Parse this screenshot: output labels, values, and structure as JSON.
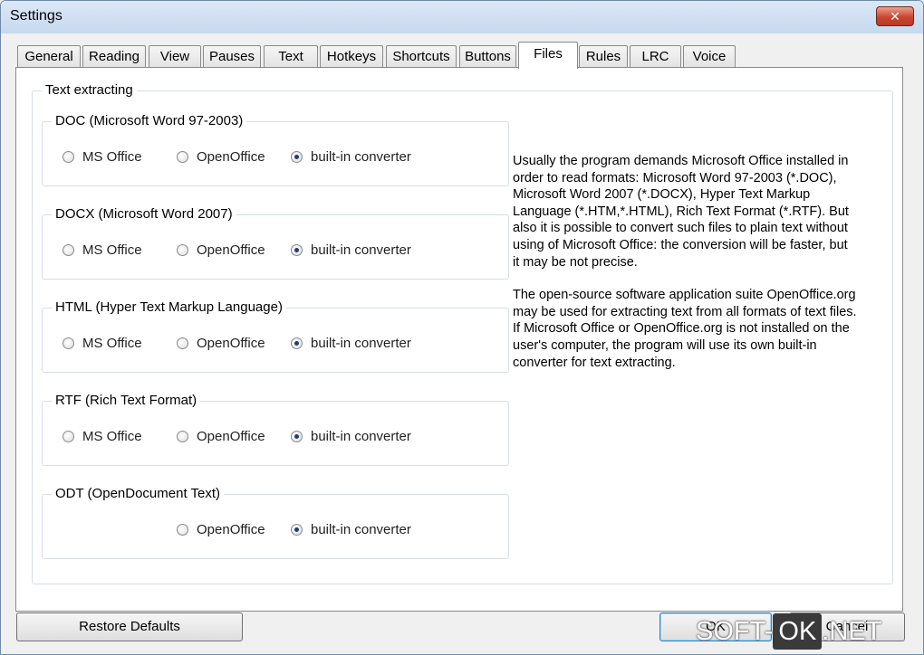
{
  "window": {
    "title": "Settings",
    "close_symbol": "✕"
  },
  "tabs": [
    {
      "label": "General"
    },
    {
      "label": "Reading"
    },
    {
      "label": "View"
    },
    {
      "label": "Pauses"
    },
    {
      "label": "Text"
    },
    {
      "label": "Hotkeys"
    },
    {
      "label": "Shortcuts"
    },
    {
      "label": "Buttons"
    },
    {
      "label": "Files",
      "active": true
    },
    {
      "label": "Rules"
    },
    {
      "label": "LRC"
    },
    {
      "label": "Voice"
    }
  ],
  "text_extracting": {
    "title": "Text extracting",
    "groups": [
      {
        "title": "DOC (Microsoft Word 97-2003)",
        "options": {
          "ms_office": "MS Office",
          "openoffice": "OpenOffice",
          "builtin": "built-in converter"
        },
        "selected": "builtin"
      },
      {
        "title": "DOCX (Microsoft Word 2007)",
        "options": {
          "ms_office": "MS Office",
          "openoffice": "OpenOffice",
          "builtin": "built-in converter"
        },
        "selected": "builtin"
      },
      {
        "title": "HTML (Hyper Text Markup Language)",
        "options": {
          "ms_office": "MS Office",
          "openoffice": "OpenOffice",
          "builtin": "built-in converter"
        },
        "selected": "builtin"
      },
      {
        "title": "RTF (Rich Text Format)",
        "options": {
          "ms_office": "MS Office",
          "openoffice": "OpenOffice",
          "builtin": "built-in converter"
        },
        "selected": "builtin"
      },
      {
        "title": "ODT (OpenDocument Text)",
        "options": {
          "openoffice": "OpenOffice",
          "builtin": "built-in converter"
        },
        "selected": "builtin"
      }
    ],
    "info_paragraph_1": "Usually the program demands Microsoft Office installed in order to read formats: Microsoft Word 97-2003 (*.DOC), Microsoft Word 2007 (*.DOCX), Hyper Text Markup Language (*.HTM,*.HTML), Rich Text Format (*.RTF). But also it is possible to convert such files to plain text without using of Microsoft Office: the conversion will be faster, but it may be not precise.",
    "info_paragraph_2": "The open-source software application suite OpenOffice.org may be used for extracting text from all formats of text files. If Microsoft Office or OpenOffice.org is not installed on the user's computer, the program will use its own built-in converter for text extracting."
  },
  "buttons": {
    "restore_defaults": "Restore Defaults",
    "ok": "OK",
    "cancel": "Cancel"
  },
  "watermark": {
    "left": "SOFT-",
    "box": "OK",
    "right": ".NET"
  },
  "colors": {
    "title_bar": "#c6d9ef",
    "close_button": "#c9452f",
    "default_button_border": "#3c7fb1"
  }
}
